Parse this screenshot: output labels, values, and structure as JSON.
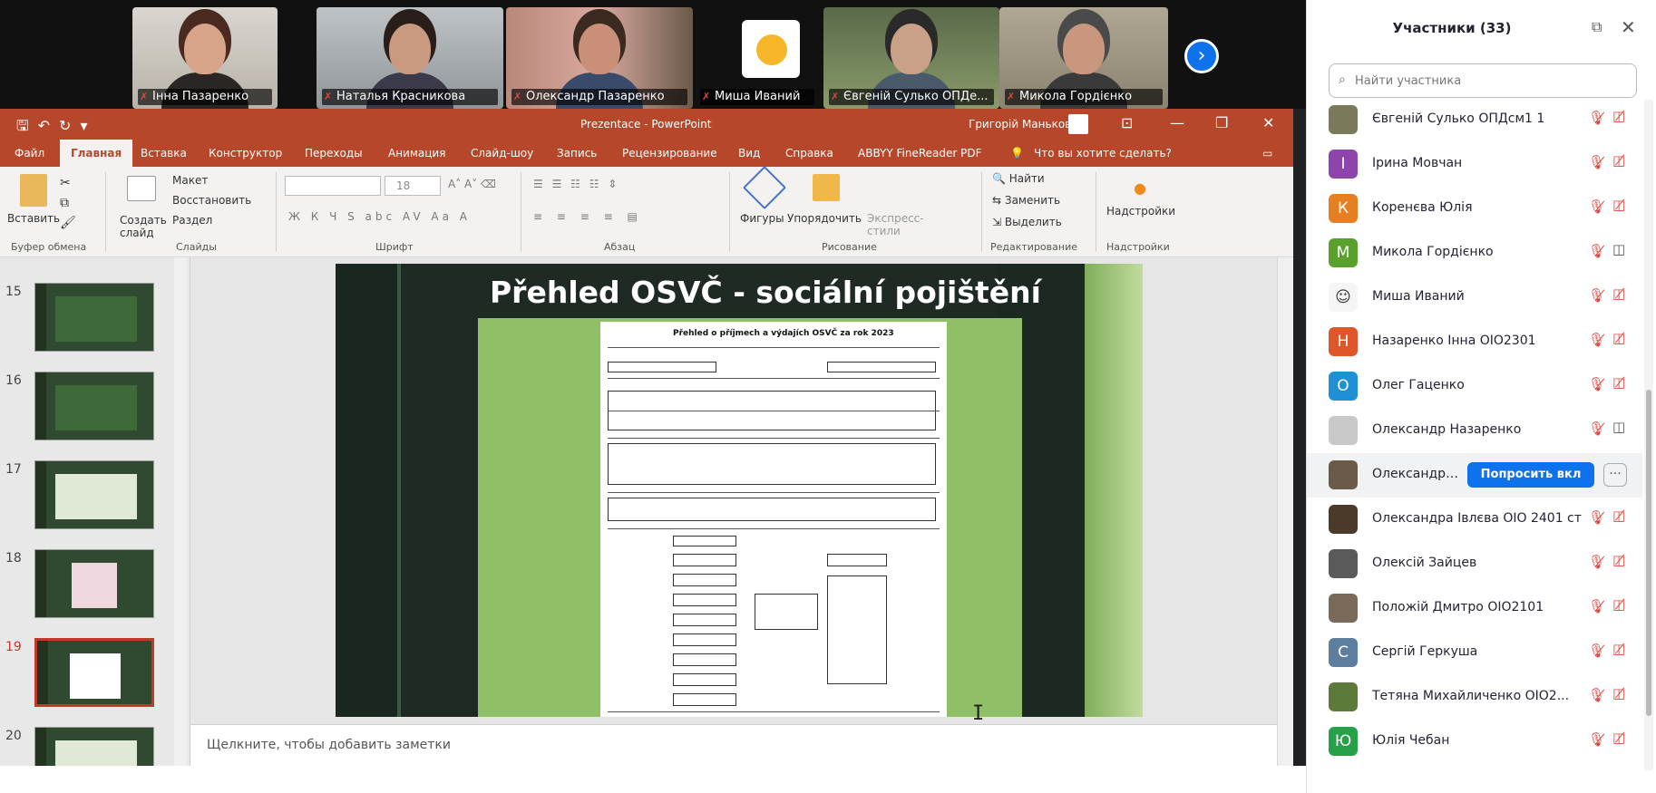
{
  "video_strip": {
    "tiles": [
      {
        "name": "Інна Пазаренко"
      },
      {
        "name": "Наталья Красникова"
      },
      {
        "name": "Олександр Пазаренко"
      },
      {
        "name": "Миша Иваний"
      },
      {
        "name": "Євгеній Сулько ОПДе..."
      },
      {
        "name": "Микола Гордієнко"
      }
    ],
    "next_label": "›"
  },
  "powerpoint": {
    "doc_title": "Prezentace - PowerPoint",
    "user_name": "Григорій Маньков",
    "menu": [
      "Файл",
      "Главная",
      "Вставка",
      "Конструктор",
      "Переходы",
      "Анимация",
      "Слайд-шоу",
      "Запись",
      "Рецензирование",
      "Вид",
      "Справка",
      "ABBYY FineReader PDF",
      "Что вы хотите сделать?"
    ],
    "ribbon": {
      "paste": "Вставить",
      "create_slide": "Создать слайд",
      "layout": "Макет",
      "reset": "Восстановить",
      "section": "Раздел",
      "font_size": "18",
      "shapes": "Фигуры",
      "arrange": "Упорядочить",
      "express": "Экспресс-стили",
      "find": "Найти",
      "replace": "Заменить",
      "select": "Выделить",
      "addins": "Надстройки",
      "groups": [
        "Буфер обмена",
        "Слайды",
        "Шрифт",
        "Абзац",
        "Рисование",
        "Редактирование",
        "Надстройки"
      ]
    },
    "thumbnails": [
      "15",
      "16",
      "17",
      "18",
      "19",
      "20"
    ],
    "selected_slide": "19",
    "slide_title": "Přehled OSVČ - sociální pojištění",
    "form_title": "Přehled o příjmech a výdajích OSVČ za rok 2023",
    "notes_placeholder": "Щелкните, чтобы добавить заметки"
  },
  "participants": {
    "title": "Участники (33)",
    "search_placeholder": "Найти участника",
    "ask_button": "Попросить вкл",
    "more_button": "···",
    "list": [
      {
        "name": "Євгеній Сулько ОПДсм1 1",
        "initial": "",
        "color": "#7a7a5a",
        "cam": "off"
      },
      {
        "name": "Ірина Мовчан",
        "initial": "I",
        "color": "#8e44ad",
        "cam": "off"
      },
      {
        "name": "Коренєва Юлія",
        "initial": "К",
        "color": "#e67e22",
        "cam": "off"
      },
      {
        "name": "Микола Гордієнко",
        "initial": "M",
        "color": "#5aa02c",
        "cam": "on"
      },
      {
        "name": "Миша Иваний",
        "initial": "",
        "color": "#f5f5f5",
        "cam": "off"
      },
      {
        "name": "Назаренко Інна ОІО2301",
        "initial": "Н",
        "color": "#e0562b",
        "cam": "off"
      },
      {
        "name": "Олег Гаценко",
        "initial": "О",
        "color": "#1f8fd6",
        "cam": "off"
      },
      {
        "name": "Олександр Назаренко",
        "initial": "",
        "color": "#c9c9c9",
        "cam": "on"
      },
      {
        "name": "Олександра Г...",
        "initial": "",
        "color": "#6b5a4a",
        "cam": "off"
      },
      {
        "name": "Олександра Івлєва ОІО 2401 ст",
        "initial": "",
        "color": "#4a3a2a",
        "cam": "off"
      },
      {
        "name": "Олексій Зайцев",
        "initial": "",
        "color": "#5a5a5a",
        "cam": "off"
      },
      {
        "name": "Положій Дмитро ОІО2101",
        "initial": "",
        "color": "#7a6a5a",
        "cam": "off"
      },
      {
        "name": "Сергій Геркуша",
        "initial": "С",
        "color": "#5d7e9e",
        "cam": "off"
      },
      {
        "name": "Тетяна Михайличенко ОІО2...",
        "initial": "",
        "color": "#5e7a3a",
        "cam": "off"
      },
      {
        "name": "Юлія Чебан",
        "initial": "Ю",
        "color": "#27a04a",
        "cam": "off"
      }
    ]
  }
}
